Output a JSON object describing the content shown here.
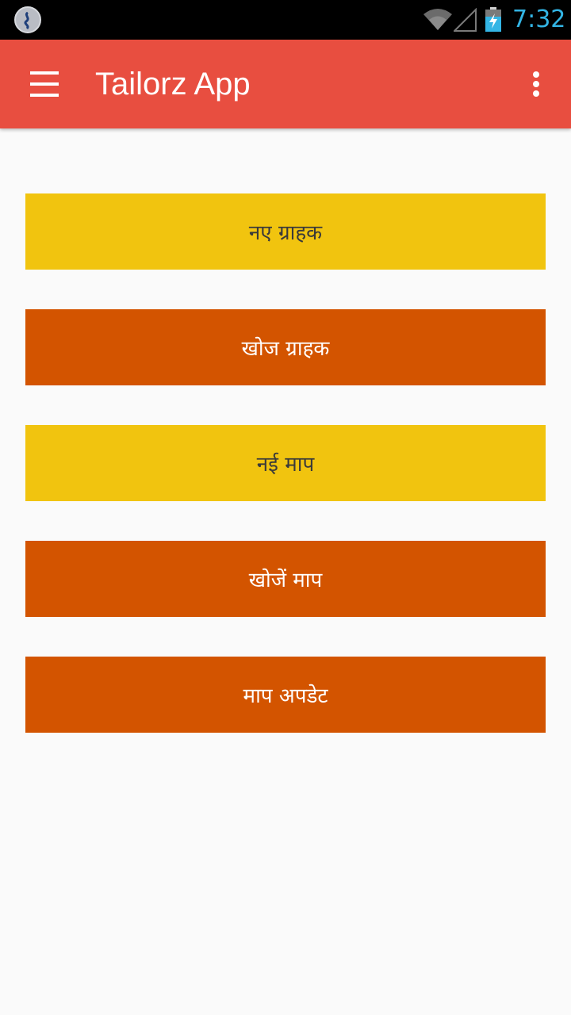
{
  "status_bar": {
    "time": "7:32",
    "icons": [
      "app-notification-icon",
      "wifi-icon",
      "signal-icon",
      "battery-charging-icon"
    ],
    "time_color": "#33b5e5"
  },
  "app_bar": {
    "title": "Tailorz App",
    "background_color": "#e84e40",
    "left_icon": "menu-icon",
    "right_icon": "overflow-menu-icon"
  },
  "main": {
    "buttons": [
      {
        "label": "नए ग्राहक",
        "color": "#f1c40f"
      },
      {
        "label": "खोज ग्राहक",
        "color": "#d35400"
      },
      {
        "label": "नई माप",
        "color": "#f1c40f"
      },
      {
        "label": "खोजें माप",
        "color": "#d35400"
      },
      {
        "label": "माप अपडेट",
        "color": "#d35400"
      }
    ]
  }
}
